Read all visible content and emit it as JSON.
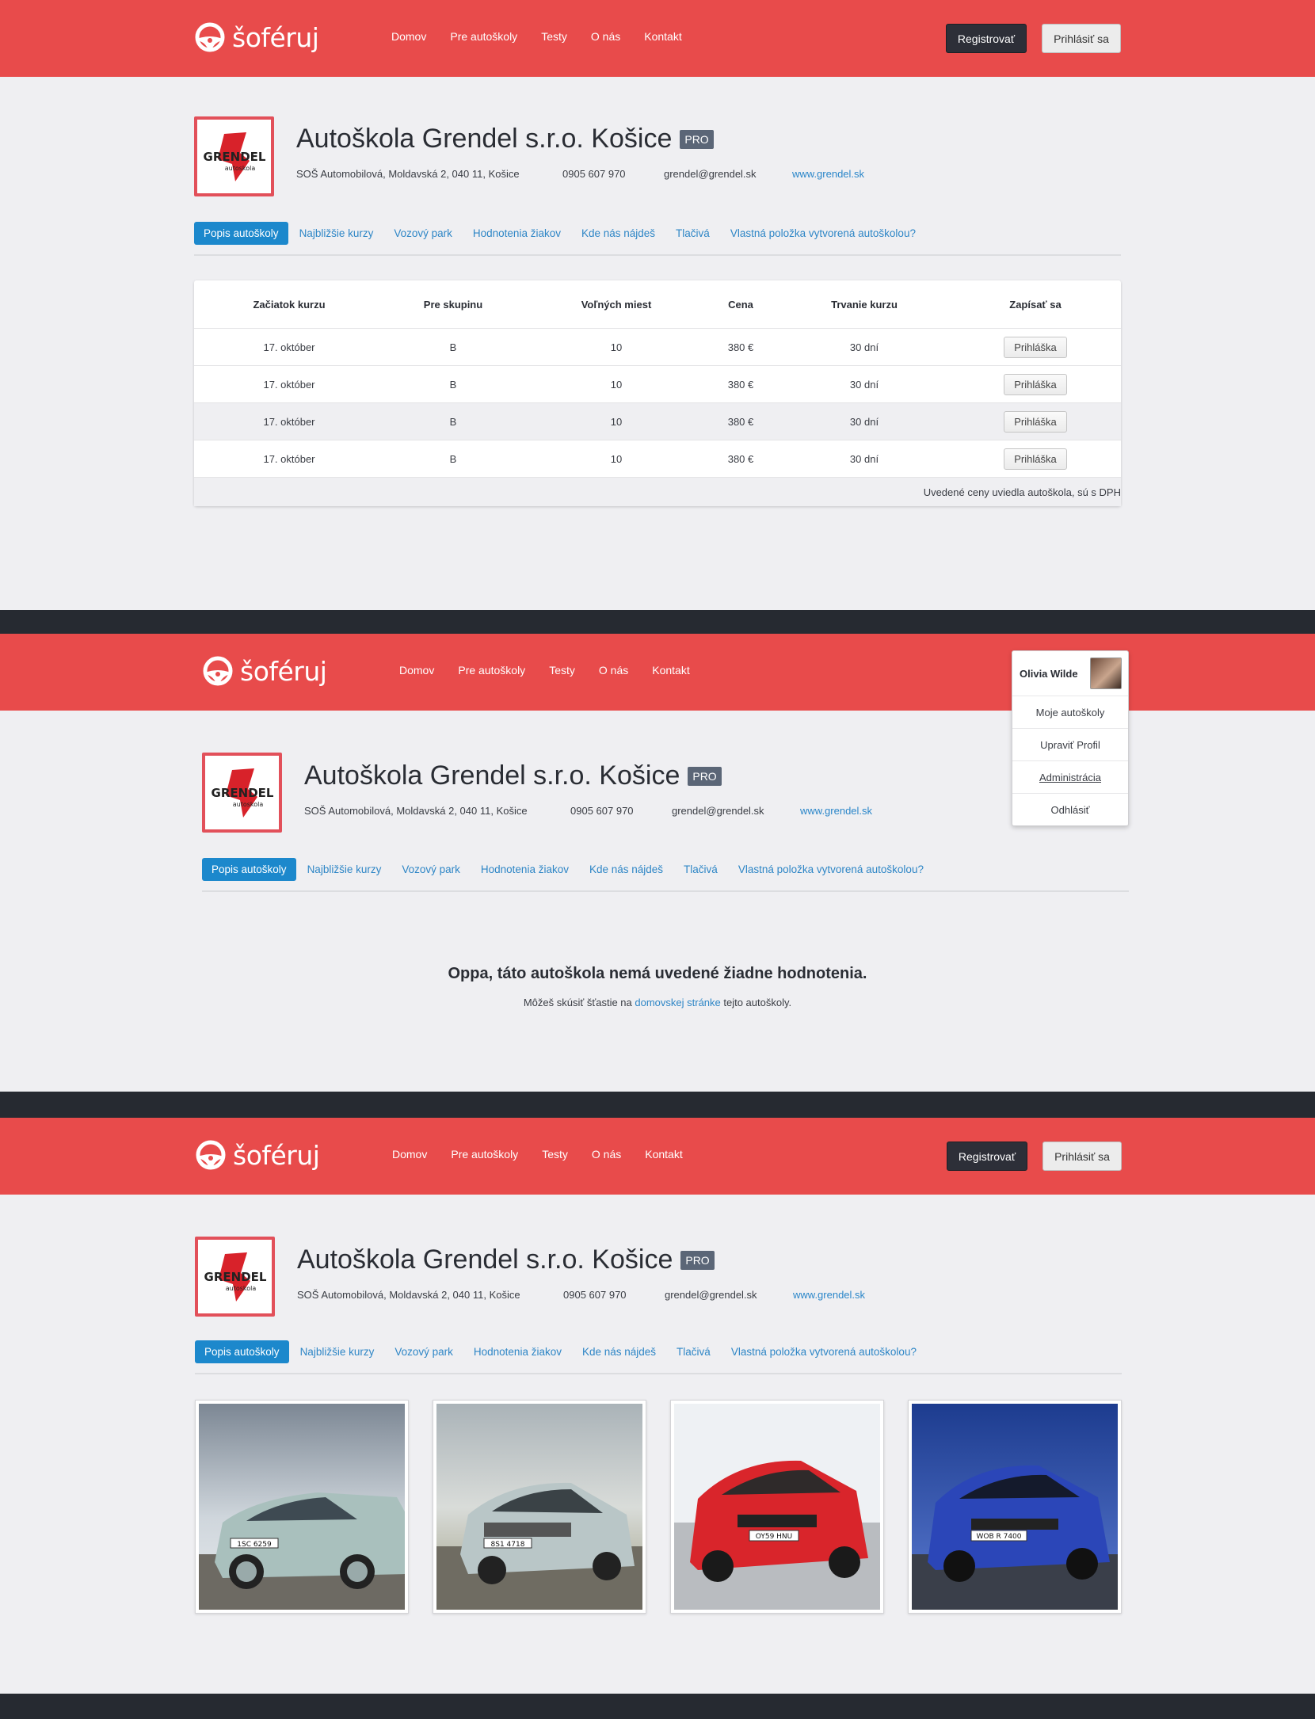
{
  "brand": {
    "name": "šoféruj",
    "accent": "#e84b4b",
    "dark": "#262a31",
    "link": "#2e86c6"
  },
  "nav": [
    "Domov",
    "Pre autoškoly",
    "Testy",
    "O nás",
    "Kontakt"
  ],
  "auth": {
    "register": "Registrovať",
    "login": "Prihlásiť sa"
  },
  "user": {
    "name": "Olivia Wilde",
    "menu": [
      "Moje autoškoly",
      "Upraviť Profil",
      "Administrácia",
      "Odhlásiť"
    ]
  },
  "school": {
    "logo_text": "GRENDEL",
    "logo_sub": "autoskola",
    "title": "Autoškola Grendel s.r.o. Košice",
    "badge": "PRO",
    "address": "SOŠ Automobilová, Moldavská 2, 040 11, Košice",
    "phone": "0905 607 970",
    "email": "grendel@grendel.sk",
    "web": "www.grendel.sk"
  },
  "tabs": [
    "Popis autoškoly",
    "Najbližšie kurzy",
    "Vozový park",
    "Hodnotenia žiakov",
    "Kde nás nájdeš",
    "Tlačivá",
    "Vlastná položka vytvorená autoškolou?"
  ],
  "courses": {
    "headers": [
      "Začiatok kurzu",
      "Pre skupinu",
      "Voľných miest",
      "Cena",
      "Trvanie kurzu",
      "Zapísať sa"
    ],
    "rows": [
      [
        "17. október",
        "B",
        "10",
        "380 €",
        "30 dní",
        "Prihláška"
      ],
      [
        "17. október",
        "B",
        "10",
        "380 €",
        "30 dní",
        "Prihláška"
      ],
      [
        "17. október",
        "B",
        "10",
        "380 €",
        "30 dní",
        "Prihláška"
      ],
      [
        "17. október",
        "B",
        "10",
        "380 €",
        "30 dní",
        "Prihláška"
      ]
    ],
    "note": "Uvedené ceny uviedla autoškola, sú s DPH"
  },
  "reviews_empty": {
    "title": "Oppa, táto autoškola nemá uvedené žiadne hodnotenia.",
    "before": "Môžeš skúsiť šťastie na ",
    "link": "domovskej stránke",
    "after": " tejto autoškoly."
  },
  "fleet": [
    {
      "plate": "1SC 6259",
      "color": "#a9c0bd"
    },
    {
      "plate": "8S1 4718",
      "color": "#b9c6c7"
    },
    {
      "plate": "OY59 HNU",
      "color": "#d9252b"
    },
    {
      "plate": "WOB R 7400",
      "color": "#2b46b8"
    }
  ]
}
